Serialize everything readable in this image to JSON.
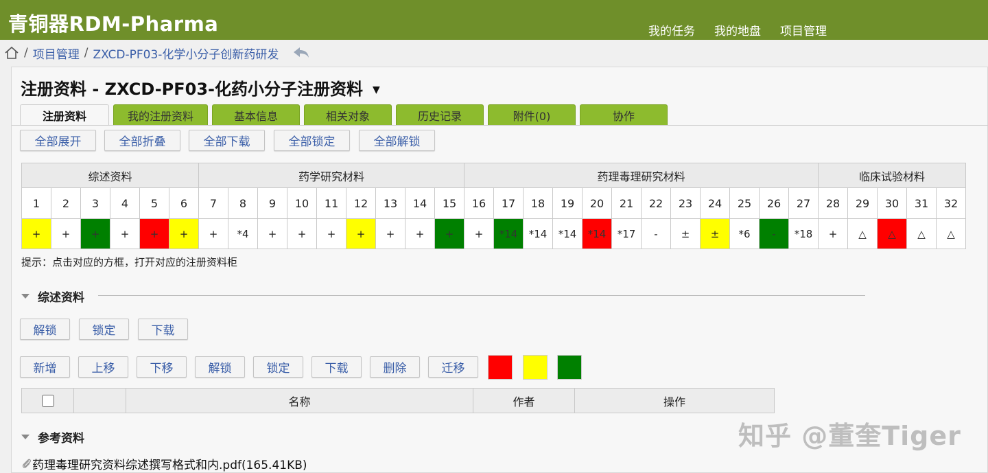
{
  "app": {
    "brand": "青铜器RDM-Pharma"
  },
  "topnav": [
    "我的任务",
    "我的地盘",
    "项目管理"
  ],
  "breadcrumb": {
    "sep": "/",
    "items": [
      "项目管理",
      "ZXCD-PF03-化学小分子创新药研发"
    ]
  },
  "page": {
    "title": "注册资料 - ZXCD-PF03-化药小分子注册资料",
    "caret": "▼"
  },
  "tabs": [
    "注册资料",
    "我的注册资料",
    "基本信息",
    "相关对象",
    "历史记录",
    "附件(0)",
    "协作"
  ],
  "toolbar": [
    "全部展开",
    "全部折叠",
    "全部下载",
    "全部锁定",
    "全部解锁"
  ],
  "grid": {
    "groups": [
      {
        "label": "综述资料",
        "span": 6
      },
      {
        "label": "药学研究材料",
        "span": 9
      },
      {
        "label": "药理毒理研究材料",
        "span": 12
      },
      {
        "label": "临床试验材料",
        "span": 5
      }
    ],
    "numbers": [
      "1",
      "2",
      "3",
      "4",
      "5",
      "6",
      "7",
      "8",
      "9",
      "10",
      "11",
      "12",
      "13",
      "14",
      "15",
      "16",
      "17",
      "18",
      "19",
      "20",
      "21",
      "22",
      "23",
      "24",
      "25",
      "26",
      "27",
      "28",
      "29",
      "30",
      "31",
      "32"
    ],
    "values": [
      "+",
      "+",
      "+",
      "+",
      "+",
      "+",
      "+",
      "*4",
      "+",
      "+",
      "+",
      "+",
      "+",
      "+",
      "+",
      "+",
      "*14",
      "*14",
      "*14",
      "*14",
      "*17",
      "-",
      "±",
      "±",
      "*6",
      "-",
      "*18",
      "+",
      "△",
      "△",
      "△",
      "△"
    ],
    "colors": [
      "#ffff00",
      "#ffffff",
      "#008000",
      "#ffffff",
      "#ff0000",
      "#ffff00",
      "#ffffff",
      "#ffffff",
      "#ffffff",
      "#ffffff",
      "#ffffff",
      "#ffff00",
      "#ffffff",
      "#ffffff",
      "#008000",
      "#ffffff",
      "#008000",
      "#ffffff",
      "#ffffff",
      "#ff0000",
      "#ffffff",
      "#ffffff",
      "#ffffff",
      "#ffff00",
      "#ffffff",
      "#008000",
      "#ffffff",
      "#ffffff",
      "#ffffff",
      "#ff0000",
      "#ffffff",
      "#ffffff"
    ]
  },
  "hint": "提示：点击对应的方框，打开对应的注册资料柜",
  "section1": {
    "title": "综述资料",
    "row1": [
      "解锁",
      "锁定",
      "下载"
    ],
    "row2": [
      "新增",
      "上移",
      "下移",
      "解锁",
      "锁定",
      "下载",
      "删除",
      "迁移"
    ],
    "swatches": [
      "#ff0000",
      "#ffff00",
      "#008000"
    ],
    "table_headers": [
      "名称",
      "作者",
      "操作"
    ]
  },
  "section2": {
    "title": "参考资料",
    "file": "药理毒理研究资料综述撰写格式和内.pdf(165.41KB)"
  },
  "watermark": "知乎 @董奎Tiger"
}
